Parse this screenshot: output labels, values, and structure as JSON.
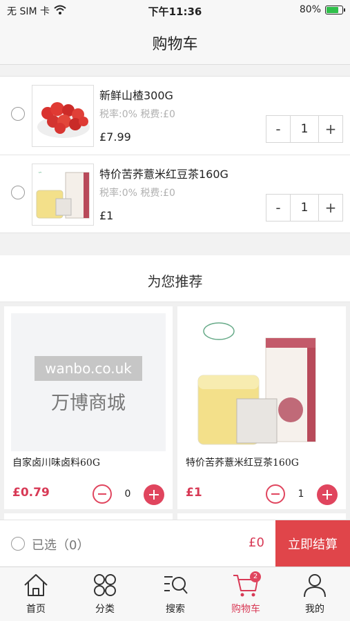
{
  "status_bar": {
    "carrier": "无 SIM 卡",
    "time": "下午11:36",
    "battery": "80%",
    "battery_level": 0.8
  },
  "nav": {
    "title": "购物车"
  },
  "cart": {
    "items": [
      {
        "name": "新鲜山楂300G",
        "tax": "税率:0% 税费:£0",
        "price": "£7.99",
        "qty": "1",
        "minus": "-",
        "plus": "+"
      },
      {
        "name": "特价苦荞薏米红豆茶160G",
        "tax": "税率:0% 税费:£0",
        "price": "£1",
        "qty": "1",
        "minus": "-",
        "plus": "+"
      }
    ]
  },
  "recommend": {
    "title": "为您推荐",
    "cards": [
      {
        "name": "自家卤川味卤料60G",
        "price": "£0.79",
        "qty": "0",
        "placeholder_domain": "wanbo.co.uk",
        "placeholder_brand": "万博商城"
      },
      {
        "name": "特价苦荞薏米红豆茶160G",
        "price": "£1",
        "qty": "1"
      }
    ]
  },
  "checkout": {
    "selected_label": "已选（0）",
    "total": "£0",
    "button": "立即结算"
  },
  "tabbar": {
    "items": [
      {
        "label": "首页",
        "icon": "home-icon"
      },
      {
        "label": "分类",
        "icon": "category-icon"
      },
      {
        "label": "搜索",
        "icon": "search-icon"
      },
      {
        "label": "购物车",
        "icon": "cart-icon",
        "badge": "2",
        "active": true
      },
      {
        "label": "我的",
        "icon": "user-icon"
      }
    ]
  },
  "colors": {
    "accent": "#e0455e",
    "price_red": "#d83a56",
    "checkout_button": "#e0454a"
  }
}
